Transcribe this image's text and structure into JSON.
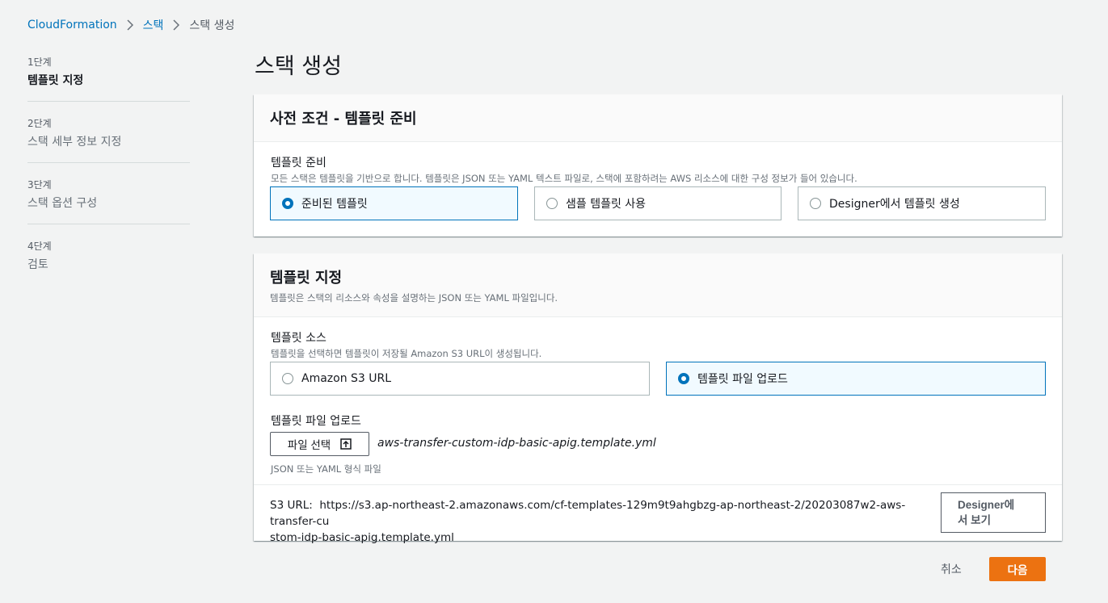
{
  "breadcrumb": {
    "items": [
      "CloudFormation",
      "스택",
      "스택 생성"
    ]
  },
  "steps": [
    {
      "num": "1단계",
      "title": "템플릿 지정"
    },
    {
      "num": "2단계",
      "title": "스택 세부 정보 지정"
    },
    {
      "num": "3단계",
      "title": "스택 옵션 구성"
    },
    {
      "num": "4단계",
      "title": "검토"
    }
  ],
  "page_title": "스택 생성",
  "prereq": {
    "title": "사전 조건 - 템플릿 준비",
    "label": "템플릿 준비",
    "desc": "모든 스택은 템플릿을 기반으로 합니다. 템플릿은 JSON 또는 YAML 텍스트 파일로, 스택에 포함하려는 AWS 리소스에 대한 구성 정보가 들어 있습니다.",
    "options": [
      "준비된 템플릿",
      "샘플 템플릿 사용",
      "Designer에서 템플릿 생성"
    ],
    "selected_option": "준비된 템플릿"
  },
  "template": {
    "title": "템플릿 지정",
    "desc": "템플릿은 스택의 리소스와 속성을 설명하는 JSON 또는 YAML 파일입니다.",
    "source_label": "템플릿 소스",
    "source_desc": "템플릿을 선택하면 템플릿이 저장될 Amazon S3 URL이 생성됩니다.",
    "source_options": [
      "Amazon S3 URL",
      "템플릿 파일 업로드"
    ],
    "selected_source": "템플릿 파일 업로드",
    "upload_label": "템플릿 파일 업로드",
    "choose_file_label": "파일 선택",
    "file_name": "aws-transfer-custom-idp-basic-apig.template.yml",
    "file_hint": "JSON 또는 YAML 형식 파일",
    "s3_url_label": "S3 URL:",
    "s3_url_line1": "https://s3.ap-northeast-2.amazonaws.com/cf-templates-129m9t9ahgbzg-ap-northeast-2/20203087w2-aws-transfer-cu",
    "s3_url_line2": "stom-idp-basic-apig.template.yml",
    "designer_button_line1": "Designer에",
    "designer_button_line2": "서 보기"
  },
  "footer": {
    "cancel_label": "취소",
    "next_label": "다음"
  },
  "colors": {
    "accent": "#0073bb",
    "primary_button": "#ec7211"
  }
}
